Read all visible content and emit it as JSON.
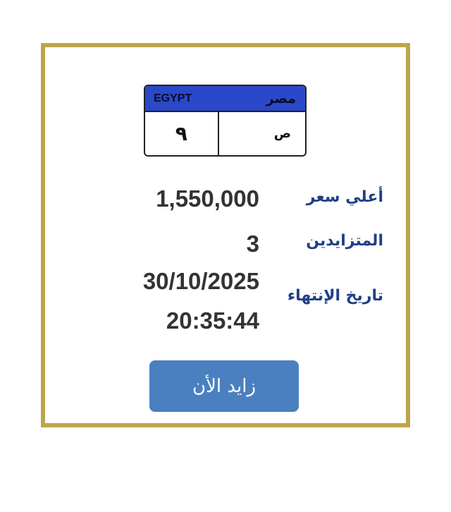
{
  "plate": {
    "country_en": "EGYPT",
    "country_ar": "مصر",
    "number": "٩",
    "letter": "ص"
  },
  "details": {
    "highest_price_label": "أعلي سعر",
    "highest_price_value": "1,550,000",
    "bidders_label": "المتزايدين",
    "bidders_value": "3",
    "end_date_label": "تاريخ الإنتهاء",
    "end_date_value": "30/10/2025",
    "end_time_value": "20:35:44"
  },
  "actions": {
    "bid_now_label": "زايد الأن"
  },
  "colors": {
    "frame": "#bda54c",
    "plate_header": "#2a48c9",
    "label": "#1f3f86",
    "button": "#4a80c0"
  }
}
